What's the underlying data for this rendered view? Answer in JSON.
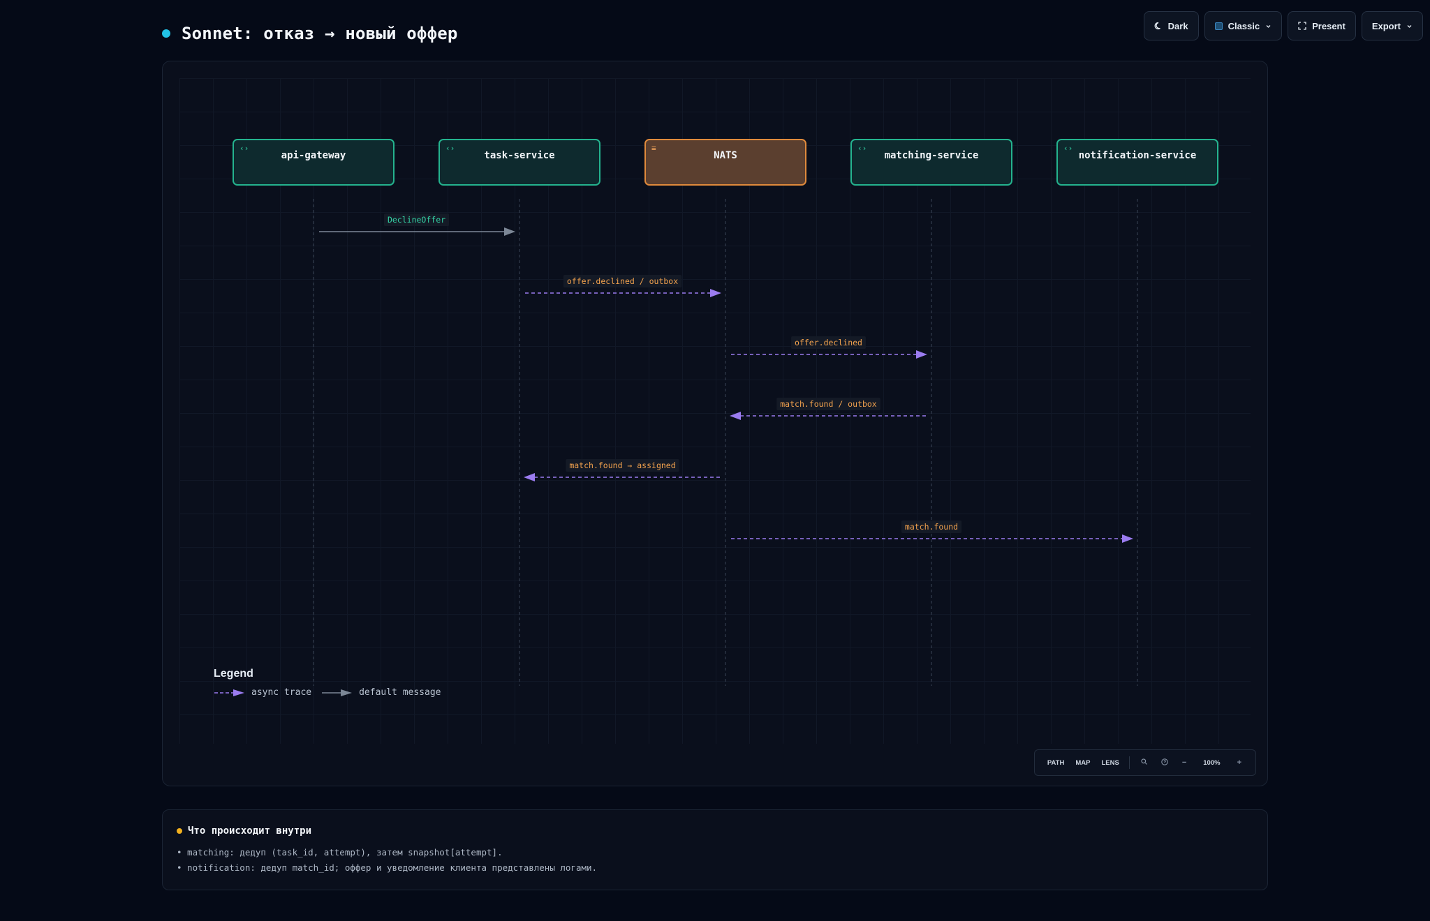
{
  "header": {
    "title": "Sonnet: отказ → новый оффер"
  },
  "toolbar": {
    "dark_label": "Dark",
    "theme_label": "Classic",
    "present_label": "Present",
    "export_label": "Export"
  },
  "participants": [
    {
      "label": "api-gateway",
      "kind": "service"
    },
    {
      "label": "task-service",
      "kind": "service"
    },
    {
      "label": "NATS",
      "kind": "broker"
    },
    {
      "label": "matching-service",
      "kind": "service"
    },
    {
      "label": "notification-service",
      "kind": "service"
    }
  ],
  "messages": [
    {
      "from": 0,
      "to": 1,
      "label": "DeclineOffer",
      "style": "default"
    },
    {
      "from": 1,
      "to": 2,
      "label": "offer.declined / outbox",
      "style": "async"
    },
    {
      "from": 2,
      "to": 3,
      "label": "offer.declined",
      "style": "async"
    },
    {
      "from": 3,
      "to": 2,
      "label": "match.found / outbox",
      "style": "async"
    },
    {
      "from": 2,
      "to": 1,
      "label": "match.found → assigned",
      "style": "async"
    },
    {
      "from": 2,
      "to": 4,
      "label": "match.found",
      "style": "async"
    }
  ],
  "legend": {
    "title": "Legend",
    "async_label": "async trace",
    "default_label": "default message"
  },
  "zoombar": {
    "path_label": "PATH",
    "map_label": "MAP",
    "lens_label": "LENS",
    "zoom_level": "100%",
    "zoom_out_label": "−",
    "zoom_in_label": "+"
  },
  "info": {
    "title": "Что происходит внутри",
    "lines": [
      "• matching: дедуп (task_id, attempt), затем snapshot[attempt].",
      "• notification: дедуп match_id; оффер и уведомление клиента представлены логами."
    ]
  },
  "colors": {
    "service_border": "#24b38e",
    "broker_border": "#e08a3c",
    "async_arrow": "#9b7cf0",
    "default_arrow": "#7c8796",
    "async_label_text": "#f2a24e",
    "default_label_text": "#34d3a6",
    "title_dot": "#22c3e6",
    "info_dot": "#f2b01e"
  }
}
